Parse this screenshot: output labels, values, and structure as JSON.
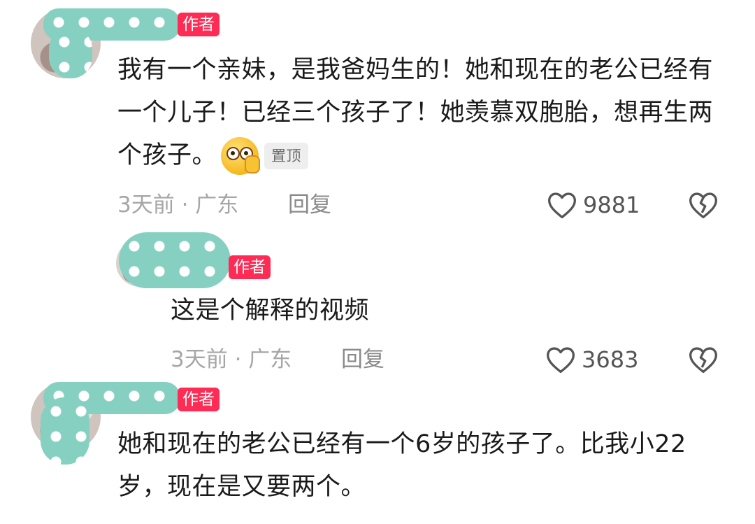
{
  "comments": [
    {
      "badge": "作者",
      "text": "我有一个亲妹，是我爸妈生的！她和现在的老公已经有一个儿子！已经三个孩子了！她羡慕双胞胎，想再生两个孩子。",
      "emoji_icon": "smiling-face-with-hand-emoji",
      "pinned_label": "置顶",
      "meta": "3天前 · 广东",
      "reply_label": "回复",
      "like_count": "9881"
    },
    {
      "badge": "作者",
      "text": "这是个解释的视频",
      "meta": "3天前 · 广东",
      "reply_label": "回复",
      "like_count": "3683"
    },
    {
      "badge": "作者",
      "text": "她和现在的老公已经有一个6岁的孩子了。比我小22岁，现在是又要两个。"
    }
  ],
  "colors": {
    "badge": "#fe2c55",
    "redaction": "#86d0c2",
    "meta_text": "#a6a6a6"
  }
}
